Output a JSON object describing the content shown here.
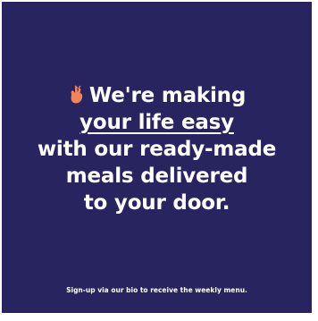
{
  "colors": {
    "background": "#27245f",
    "text": "#ffffff",
    "accent": "#f2845c"
  },
  "headline": {
    "icon": "crossed-fingers-icon",
    "line1": "We're making",
    "line2": "your life easy",
    "line3": "with our ready-made",
    "line4": "meals delivered",
    "line5": "to your door."
  },
  "footer": {
    "text": "Sign-up via our bio to receive the weekly menu."
  }
}
